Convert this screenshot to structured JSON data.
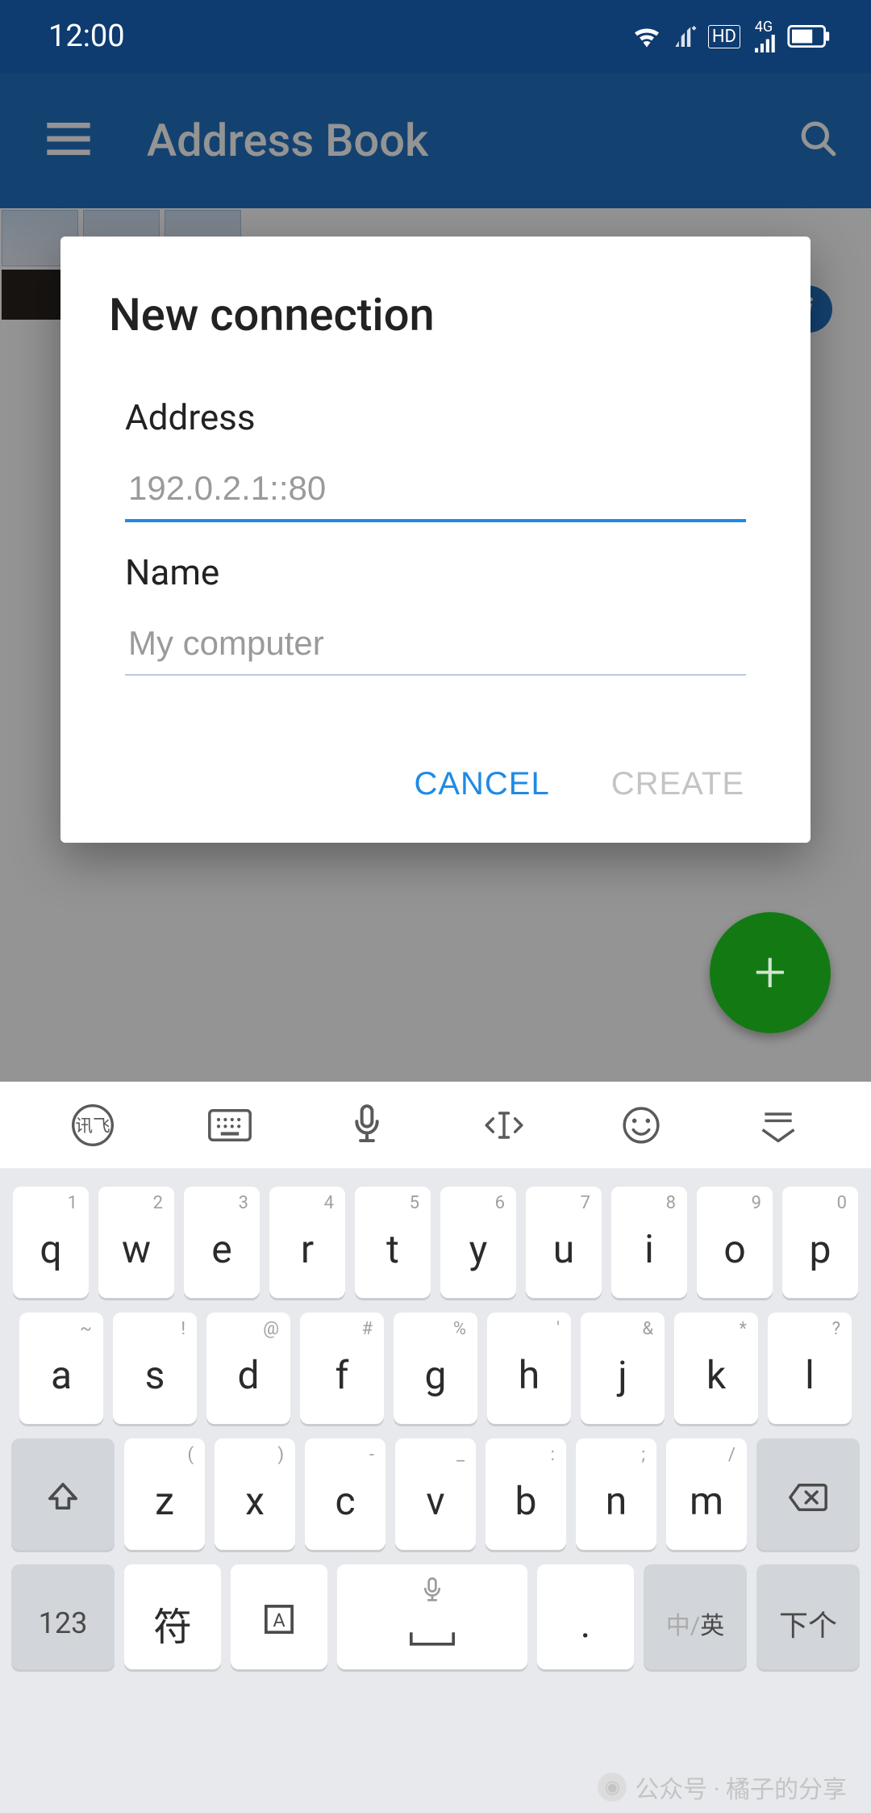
{
  "status": {
    "time": "12:00",
    "network_label": "4G",
    "hd_label": "HD"
  },
  "appbar": {
    "title": "Address Book"
  },
  "fab": {
    "plus": "+"
  },
  "badge": {
    "label": "i"
  },
  "dialog": {
    "title": "New connection",
    "address_label": "Address",
    "address_placeholder": "192.0.2.1::80",
    "address_value": "",
    "name_label": "Name",
    "name_placeholder": "My computer",
    "name_value": "",
    "cancel": "CANCEL",
    "create": "CREATE"
  },
  "keyboard": {
    "row1": [
      {
        "sup": "1",
        "main": "q"
      },
      {
        "sup": "2",
        "main": "w"
      },
      {
        "sup": "3",
        "main": "e"
      },
      {
        "sup": "4",
        "main": "r"
      },
      {
        "sup": "5",
        "main": "t"
      },
      {
        "sup": "6",
        "main": "y"
      },
      {
        "sup": "7",
        "main": "u"
      },
      {
        "sup": "8",
        "main": "i"
      },
      {
        "sup": "9",
        "main": "o"
      },
      {
        "sup": "0",
        "main": "p"
      }
    ],
    "row2": [
      {
        "sup": "~",
        "main": "a"
      },
      {
        "sup": "!",
        "main": "s"
      },
      {
        "sup": "@",
        "main": "d"
      },
      {
        "sup": "#",
        "main": "f"
      },
      {
        "sup": "%",
        "main": "g"
      },
      {
        "sup": "'",
        "main": "h"
      },
      {
        "sup": "&",
        "main": "j"
      },
      {
        "sup": "*",
        "main": "k"
      },
      {
        "sup": "?",
        "main": "l"
      }
    ],
    "row3": [
      {
        "sup": "(",
        "main": "z"
      },
      {
        "sup": ")",
        "main": "x"
      },
      {
        "sup": "-",
        "main": "c"
      },
      {
        "sup": "_",
        "main": "v"
      },
      {
        "sup": ":",
        "main": "b"
      },
      {
        "sup": ";",
        "main": "n"
      },
      {
        "sup": "/",
        "main": "m"
      }
    ],
    "bottom": {
      "num": "123",
      "sym": "符",
      "dot": ".",
      "ime": "中/英",
      "next": "下个"
    }
  },
  "watermark": {
    "text": "公众号 · 橘子的分享"
  }
}
